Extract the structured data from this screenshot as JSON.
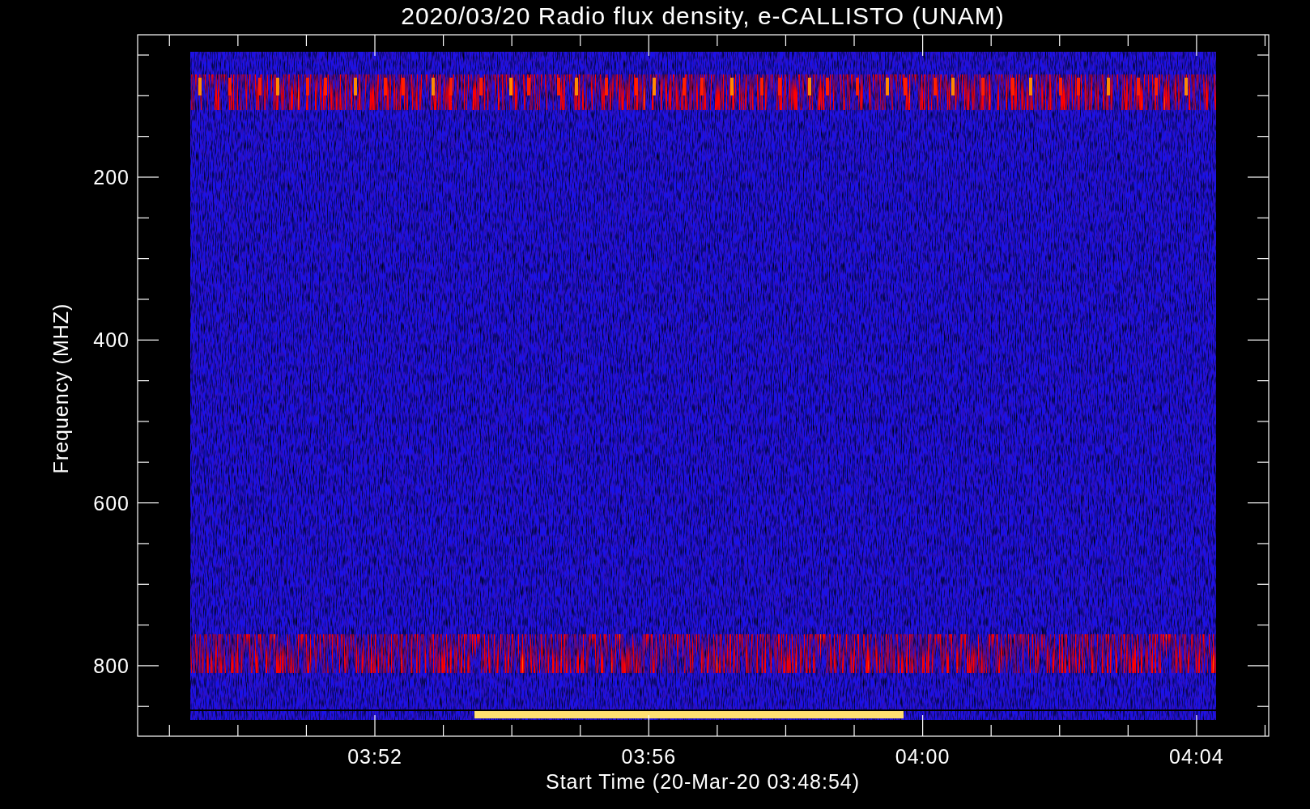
{
  "title": "2020/03/20  Radio flux density, e-CALLISTO (UNAM)",
  "y_axis": {
    "label": "Frequency (MHZ)",
    "ticks": [
      "200",
      "400",
      "600",
      "800"
    ]
  },
  "x_axis": {
    "label": "Start Time (20-Mar-20 03:48:54)",
    "ticks": [
      "03:52",
      "03:56",
      "04:00",
      "04:04"
    ]
  }
}
